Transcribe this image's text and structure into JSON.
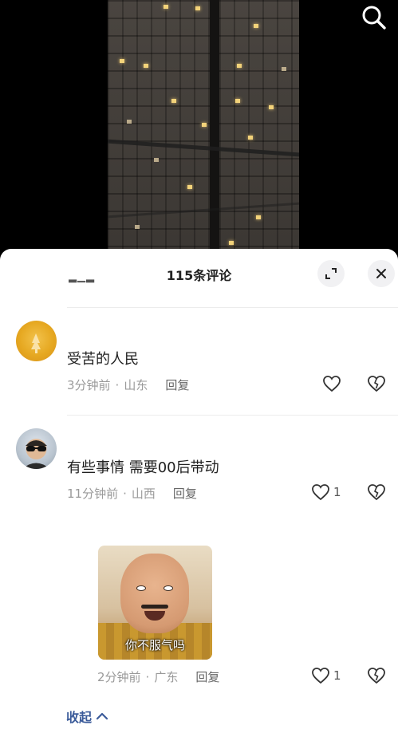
{
  "header": {
    "title": "115条评论"
  },
  "comments": [
    {
      "text": "受苦的人民",
      "time": "3分钟前",
      "location": "山东",
      "reply_label": "回复",
      "like_count": ""
    },
    {
      "text": "有些事情 需要00后带动",
      "time": "11分钟前",
      "location": "山西",
      "reply_label": "回复",
      "like_count": "1"
    },
    {
      "text": "",
      "image_caption": "你不服气吗",
      "time": "2分钟前",
      "location": "广东",
      "reply_label": "回复",
      "like_count": "1"
    }
  ],
  "collapse_label": "收起",
  "icons": {
    "search": "search-icon",
    "expand": "expand-icon",
    "close": "close-icon",
    "like": "heart-icon",
    "dislike": "broken-heart-icon",
    "chevron": "chevron-up-icon"
  },
  "colors": {
    "accent_link": "#3b5b9a",
    "meta_text": "#9a9a9a"
  }
}
